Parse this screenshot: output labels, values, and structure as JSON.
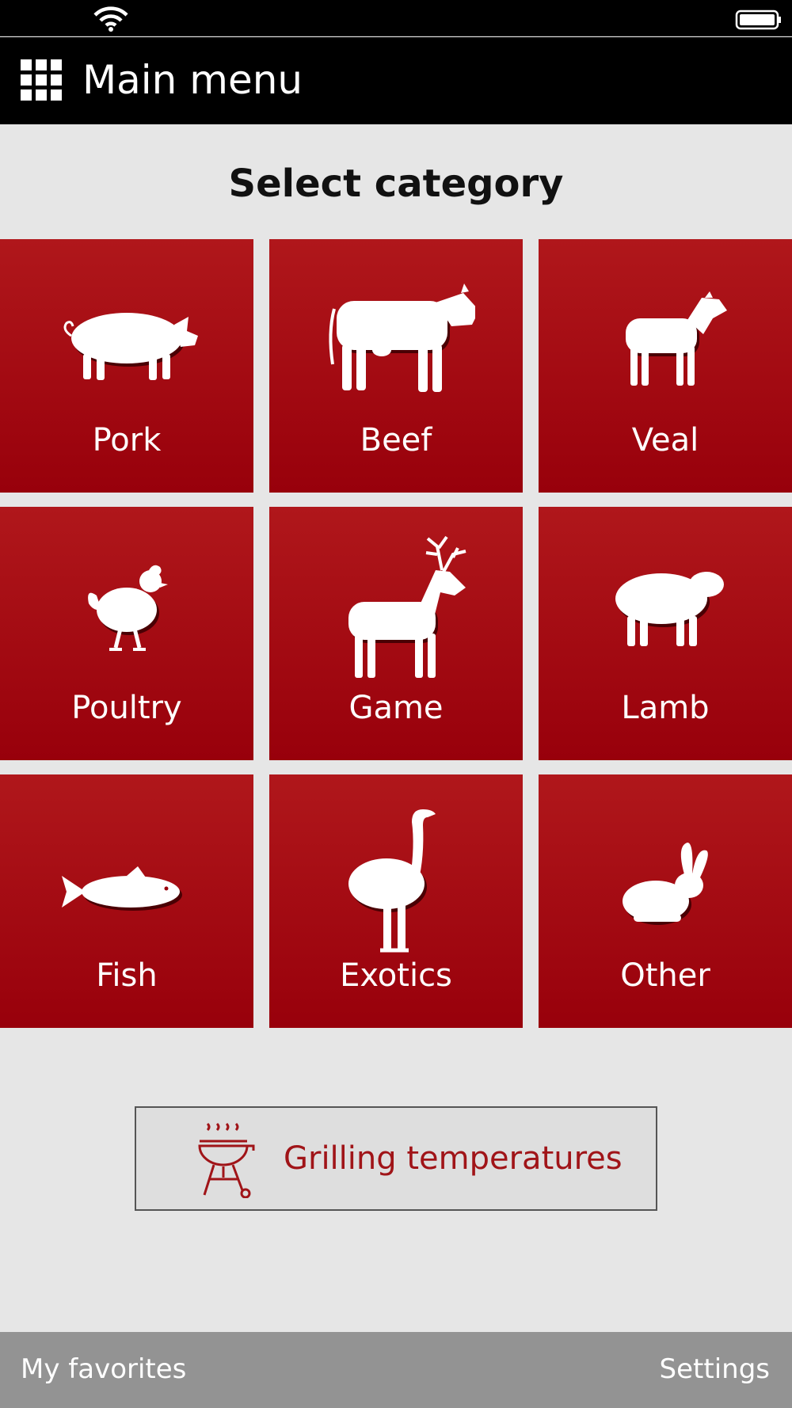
{
  "app": {
    "title": "Main menu",
    "heading": "Select category"
  },
  "status_bar": {
    "wifi_icon": "wifi-icon",
    "battery_icon": "battery-icon"
  },
  "categories": [
    {
      "label": "Pork",
      "icon": "pig-icon"
    },
    {
      "label": "Beef",
      "icon": "cow-icon"
    },
    {
      "label": "Veal",
      "icon": "calf-icon"
    },
    {
      "label": "Poultry",
      "icon": "chicken-icon"
    },
    {
      "label": "Game",
      "icon": "deer-icon"
    },
    {
      "label": "Lamb",
      "icon": "sheep-icon"
    },
    {
      "label": "Fish",
      "icon": "fish-icon"
    },
    {
      "label": "Exotics",
      "icon": "ostrich-icon"
    },
    {
      "label": "Other",
      "icon": "rabbit-icon"
    }
  ],
  "grill_button": {
    "label": "Grilling temperatures",
    "icon": "grill-icon"
  },
  "bottom_bar": {
    "favorites_label": "My favorites",
    "settings_label": "Settings"
  },
  "colors": {
    "tile_top": "#b0171b",
    "tile_bottom": "#98000b",
    "accent_text": "#a01418",
    "bar_black": "#000000",
    "bottom_bar": "#939393",
    "background": "#e6e6e6"
  }
}
